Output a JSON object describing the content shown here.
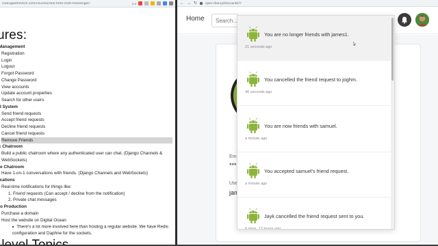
{
  "left_window": {
    "url": "codingwithmitch.com/courses/real-time-chat-messenger/",
    "zoom": "1.4",
    "page_title": "ures:",
    "lines": [
      {
        "text": "Management",
        "cls": "sec"
      },
      {
        "text": "Registration",
        "cls": "i1"
      },
      {
        "text": "Login",
        "cls": "i1"
      },
      {
        "text": "Logout",
        "cls": "i1"
      },
      {
        "text": "Forgot Password",
        "cls": "i1"
      },
      {
        "text": "Change Password",
        "cls": "i1"
      },
      {
        "text": "View accounts",
        "cls": "i1"
      },
      {
        "text": "Update account properties",
        "cls": "i1"
      },
      {
        "text": "Search for other users",
        "cls": "i1"
      },
      {
        "text": "d System",
        "cls": "sec"
      },
      {
        "text": "Send friend requests",
        "cls": "i1"
      },
      {
        "text": "Accept friend requests",
        "cls": "i1"
      },
      {
        "text": "Decline friend requests",
        "cls": "i1"
      },
      {
        "text": "Cancel friend requests",
        "cls": "i1"
      },
      {
        "text": "Remove Friends",
        "cls": "i1 sel"
      },
      {
        "text": "c Chatroom",
        "cls": "sec"
      },
      {
        "text": "Build a public chatroom where any authenticated user can chat. (Django Channels &",
        "cls": "i1"
      },
      {
        "text": "WebSockets)",
        "cls": "i1"
      },
      {
        "text": "te Chatroom",
        "cls": "sec"
      },
      {
        "text": "Have 1-on-1 conversations with friends. (Django Channels and WebSockets)",
        "cls": "i1"
      },
      {
        "text": "ications",
        "cls": "sec"
      },
      {
        "text": "Real-time notifications for things like:",
        "cls": "i1"
      },
      {
        "text": "1. Friend requests (Can accept / decline from the notification)",
        "cls": "i2"
      },
      {
        "text": "2. Private chat messages",
        "cls": "i2"
      },
      {
        "text": "to Production",
        "cls": "sec"
      },
      {
        "text": "Purchase a domain",
        "cls": "i1"
      },
      {
        "text": "Host the website on Digital Ocean",
        "cls": "i1"
      },
      {
        "text": "There's a lot more involved here than hosting a regular website. We have Redis",
        "cls": "i3 bullet"
      },
      {
        "text": "configuration and Daphne for the sockets.",
        "cls": "i3 pad"
      }
    ],
    "bottom_title": "-level Topics"
  },
  "right_window": {
    "url": "open-chat.xyz/account/1/?",
    "nav": {
      "home_label": "Home",
      "search_placeholder": "Search..."
    },
    "profile": {
      "email_label": "Ema",
      "email_value": "***",
      "username_label": "Use",
      "username_value": "jam"
    },
    "notifications": [
      {
        "text": "You are no longer friends with james1.",
        "time": "21 seconds ago",
        "hover": true
      },
      {
        "text": "You cancelled the friend request to joghm.",
        "time": "46 seconds ago",
        "hover": false
      },
      {
        "text": "You are now friends with samuel.",
        "time": "a minute ago",
        "hover": false
      },
      {
        "text": "You accepted samuel's friend request.",
        "time": "a minute ago",
        "hover": false
      },
      {
        "text": "Jayk cancelled the friend request sent to you.",
        "time": "6 days, 17 hours ago",
        "hover": false
      }
    ]
  },
  "colors": {
    "android_green": "#8cb43c",
    "panel_hover": "#f1f1f1",
    "bell_bg": "#3b3b3b"
  }
}
